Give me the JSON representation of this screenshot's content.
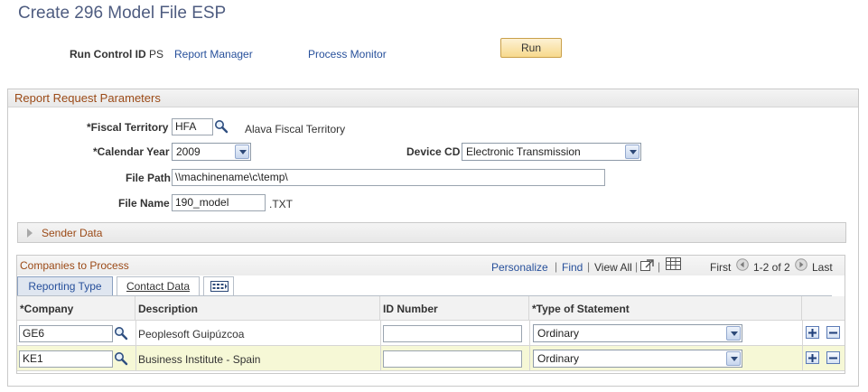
{
  "page": {
    "title": "Create 296 Model File ESP"
  },
  "header": {
    "run_control_label": "Run Control ID",
    "run_control_value": "PS",
    "report_manager_link": "Report Manager",
    "process_monitor_link": "Process Monitor",
    "run_button": "Run"
  },
  "params": {
    "group_title": "Report Request Parameters",
    "fiscal_territory_label": "*Fiscal Territory",
    "fiscal_territory_value": "HFA",
    "fiscal_territory_desc": "Alava Fiscal Territory",
    "calendar_year_label": "*Calendar Year",
    "calendar_year_value": "2009",
    "device_cd_label": "Device CD",
    "device_cd_value": "Electronic Transmission",
    "file_path_label": "File Path",
    "file_path_value": "\\\\machinename\\c\\temp\\",
    "file_name_label": "File Name",
    "file_name_value": "190_model",
    "file_ext": ".TXT"
  },
  "sender": {
    "title": "Sender Data",
    "expanded": false
  },
  "grid": {
    "title": "Companies to Process",
    "personalize": "Personalize",
    "find": "Find",
    "view_all": "View All",
    "first": "First",
    "range": "1-2 of 2",
    "last": "Last",
    "tabs": [
      {
        "label": "Reporting Type",
        "active": true
      },
      {
        "label": "Contact Data",
        "active": false
      }
    ],
    "columns": [
      "*Company",
      "Description",
      "ID Number",
      "*Type of Statement"
    ],
    "rows": [
      {
        "company": "GE6",
        "description": "Peoplesoft Guipúzcoa",
        "id_number": "",
        "type": "Ordinary"
      },
      {
        "company": "KE1",
        "description": "Business Institute - Spain",
        "id_number": "",
        "type": "Ordinary"
      }
    ]
  },
  "colors": {
    "title": "#4e5c80",
    "link": "#27509b",
    "group_title": "#9b4a17",
    "selected_row": "#f6f8d6"
  }
}
